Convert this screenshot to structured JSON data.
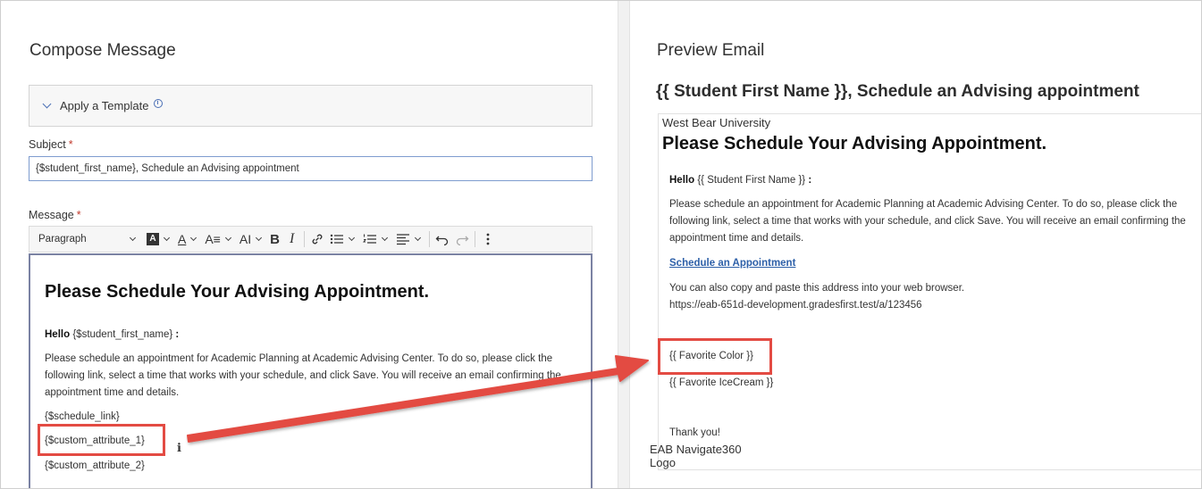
{
  "compose": {
    "title": "Compose Message",
    "template_label": "Apply a Template",
    "subject_label": "Subject",
    "required_mark": "*",
    "subject_value": "{$student_first_name}, Schedule an Advising appointment",
    "message_label": "Message",
    "toolbar": {
      "paragraph": "Paragraph",
      "bold": "B",
      "italic": "I"
    },
    "editor": {
      "heading": "Please Schedule Your Advising Appointment.",
      "hello_word": "Hello",
      "hello_var": "{$student_first_name}",
      "hello_colon": ":",
      "body": "Please schedule an appointment for Academic Planning at Academic Advising Center. To do so, please click the following link, select a time that works with your schedule, and click Save. You will receive an email confirming the appointment time and details.",
      "schedule_link": "{$schedule_link}",
      "custom_attr_1": "{$custom_attribute_1}",
      "custom_attr_2": "{$custom_attribute_2}"
    }
  },
  "preview": {
    "title": "Preview Email",
    "subject": "{{ Student First Name }}, Schedule an Advising appointment",
    "university": "West Bear University",
    "heading": "Please Schedule Your Advising Appointment.",
    "hello_word": "Hello",
    "hello_var": "{{ Student First Name }}",
    "hello_colon": ":",
    "body": "Please schedule an appointment for Academic Planning at Academic Advising Center. To do so, please click the following link, select a time that works with your schedule, and click Save. You will receive an email confirming the appointment time and details.",
    "link_text": "Schedule an Appointment",
    "copy_text": "You can also copy and paste this address into your web browser.",
    "url": "https://eab-651d-development.gradesfirst.test/a/123456",
    "favorite_color": "{{ Favorite Color }}",
    "favorite_icecream": "{{ Favorite IceCream }}",
    "thanks": "Thank you!",
    "logo_text": "EAB Navigate360 Logo"
  },
  "annotation": {
    "callout_color": "#e34b43"
  }
}
